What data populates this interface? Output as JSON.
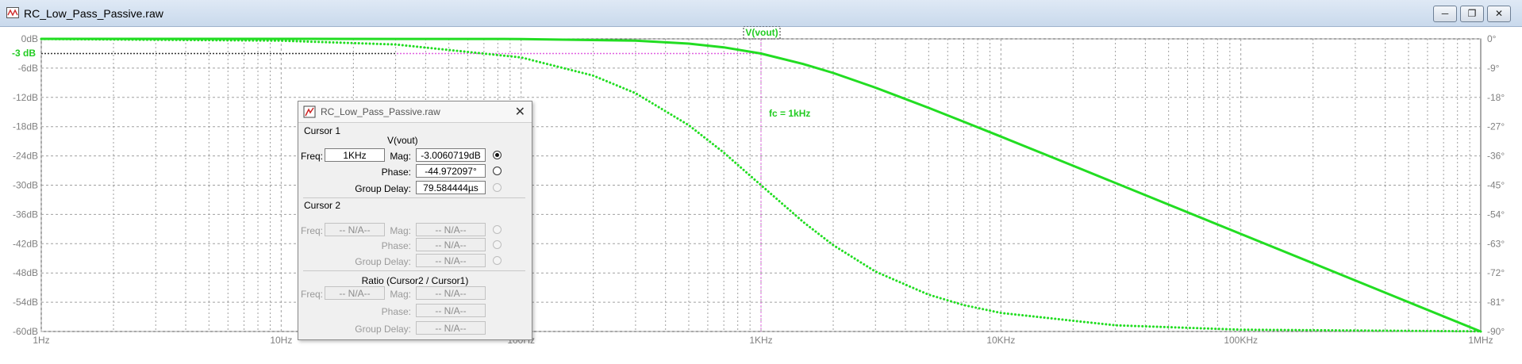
{
  "window": {
    "title": "RC_Low_Pass_Passive.raw",
    "minimize_icon": "minimize-icon",
    "restore_icon": "restore-icon",
    "close_icon": "close-icon"
  },
  "annotations": {
    "trace_label": "V(vout)",
    "minus3db_label": "-3 dB",
    "fc_label": "fc = 1kHz"
  },
  "colors": {
    "trace": "#22dd22",
    "annotation": "#22cc22",
    "marker": "#e060e0",
    "grid": "#a0a0a0",
    "axis_text": "#808080"
  },
  "cursor_panel": {
    "title": "RC_Low_Pass_Passive.raw",
    "cursor1": {
      "heading": "Cursor 1",
      "trace": "V(vout)",
      "freq_label": "Freq:",
      "freq_value": "1KHz",
      "mag_label": "Mag:",
      "mag_value": "-3.0060719dB",
      "phase_label": "Phase:",
      "phase_value": "-44.972097°",
      "gd_label": "Group Delay:",
      "gd_value": "79.584444µs"
    },
    "cursor2": {
      "heading": "Cursor 2",
      "freq_label": "Freq:",
      "freq_value": "-- N/A--",
      "mag_label": "Mag:",
      "mag_value": "-- N/A--",
      "phase_label": "Phase:",
      "phase_value": "-- N/A--",
      "gd_label": "Group Delay:",
      "gd_value": "-- N/A--"
    },
    "ratio": {
      "heading": "Ratio (Cursor2 / Cursor1)",
      "freq_label": "Freq:",
      "freq_value": "-- N/A--",
      "mag_label": "Mag:",
      "mag_value": "-- N/A--",
      "phase_label": "Phase:",
      "phase_value": "-- N/A--",
      "gd_label": "Group Delay:",
      "gd_value": "-- N/A--"
    }
  },
  "chart_data": {
    "type": "line",
    "x_scale": "log",
    "xlim": [
      1,
      1000000
    ],
    "ylim": [
      -60,
      0
    ],
    "y2lim": [
      -90,
      0
    ],
    "x_ticks": [
      1,
      10,
      100,
      1000,
      10000,
      100000,
      1000000
    ],
    "x_tick_labels": [
      "1Hz",
      "10Hz",
      "100Hz",
      "1KHz",
      "10KHz",
      "100KHz",
      "1MHz"
    ],
    "y_ticks": [
      0,
      -6,
      -12,
      -18,
      -24,
      -30,
      -36,
      -42,
      -48,
      -54,
      -60
    ],
    "y_tick_labels": [
      "0dB",
      "-6dB",
      "-12dB",
      "-18dB",
      "-24dB",
      "-30dB",
      "-36dB",
      "-42dB",
      "-48dB",
      "-54dB",
      "-60dB"
    ],
    "y2_ticks": [
      0,
      -9,
      -18,
      -27,
      -36,
      -45,
      -54,
      -63,
      -72,
      -81,
      -90
    ],
    "y2_tick_labels": [
      "0°",
      "-9°",
      "-18°",
      "-27°",
      "-36°",
      "-45°",
      "-54°",
      "-63°",
      "-72°",
      "-81°",
      "-90°"
    ],
    "grid": true,
    "series": [
      {
        "name": "V(vout)",
        "axis": "magnitude",
        "style": "solid",
        "x": [
          1,
          10,
          100,
          300,
          500,
          700,
          1000,
          1500,
          2000,
          3000,
          5000,
          7000,
          10000,
          20000,
          50000,
          100000,
          200000,
          500000,
          1000000
        ],
        "y": [
          0,
          0,
          -0.04,
          -0.37,
          -0.97,
          -1.74,
          -3.01,
          -5.16,
          -6.99,
          -10.0,
          -14.15,
          -17.0,
          -20.04,
          -26.02,
          -33.98,
          -40.0,
          -46.02,
          -53.98,
          -60.0
        ]
      },
      {
        "name": "V(vout)",
        "axis": "phase",
        "style": "dotted",
        "x": [
          1,
          10,
          30,
          100,
          200,
          300,
          500,
          700,
          1000,
          1500,
          2000,
          3000,
          5000,
          7000,
          10000,
          30000,
          100000,
          1000000
        ],
        "y": [
          -0.06,
          -0.57,
          -1.72,
          -5.71,
          -11.31,
          -16.7,
          -26.57,
          -34.99,
          -45.0,
          -56.31,
          -63.43,
          -71.57,
          -78.69,
          -81.87,
          -84.29,
          -88.09,
          -89.43,
          -89.94
        ]
      }
    ],
    "markers": {
      "minus3db_level": -3,
      "fc": 1000
    }
  }
}
